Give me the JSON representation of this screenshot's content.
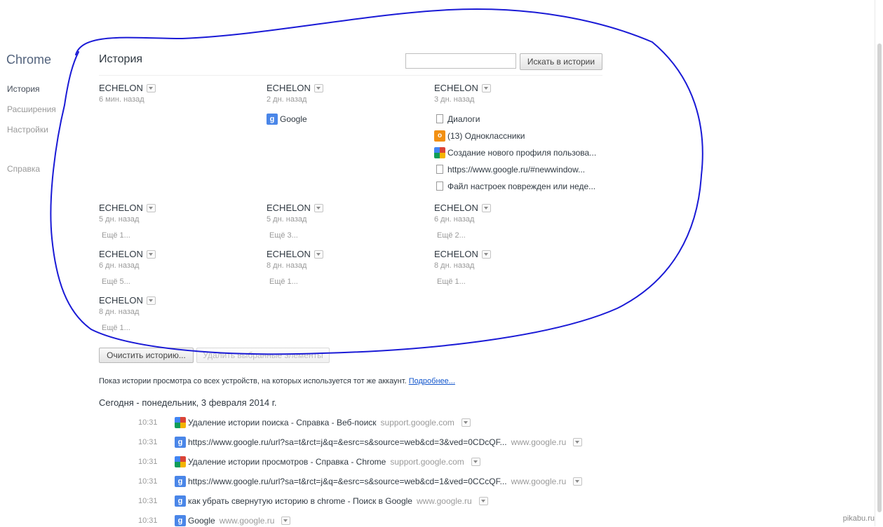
{
  "sidebar": {
    "app_title": "Chrome",
    "items": [
      {
        "label": "История",
        "active": true
      },
      {
        "label": "Расширения",
        "active": false
      },
      {
        "label": "Настройки",
        "active": false
      },
      {
        "label": "Справка",
        "active": false
      }
    ]
  },
  "header": {
    "title": "История",
    "search_placeholder": "",
    "search_button": "Искать в истории"
  },
  "devices": [
    {
      "name": "ECHELON",
      "time": "6 мин. назад",
      "tabs": []
    },
    {
      "name": "ECHELON",
      "time": "2 дн. назад",
      "tabs": [
        {
          "icon": "google-icon",
          "title": "Google"
        }
      ]
    },
    {
      "name": "ECHELON",
      "time": "3 дн. назад",
      "tabs": [
        {
          "icon": "page-icon",
          "title": "Диалоги"
        },
        {
          "icon": "odnoklassniki-icon",
          "title": "(13) Одноклассники"
        },
        {
          "icon": "google-multicolor-icon",
          "title": "Создание нового профиля пользова..."
        },
        {
          "icon": "page-icon",
          "title": "https://www.google.ru/#newwindow..."
        },
        {
          "icon": "page-icon",
          "title": "Файл настроек поврежден или неде..."
        }
      ]
    },
    {
      "name": "ECHELON",
      "time": "5 дн. назад",
      "more": "Ещё 1..."
    },
    {
      "name": "ECHELON",
      "time": "5 дн. назад",
      "more": "Ещё 3..."
    },
    {
      "name": "ECHELON",
      "time": "6 дн. назад",
      "more": "Ещё 2..."
    },
    {
      "name": "ECHELON",
      "time": "6 дн. назад",
      "more": "Ещё 5..."
    },
    {
      "name": "ECHELON",
      "time": "8 дн. назад",
      "more": "Ещё 1..."
    },
    {
      "name": "ECHELON",
      "time": "8 дн. назад",
      "more": "Ещё 1..."
    },
    {
      "name": "ECHELON",
      "time": "8 дн. назад",
      "more": "Ещё 1..."
    }
  ],
  "actions": {
    "clear_history": "Очистить историю...",
    "remove_selected": "Удалить выбранные элементы"
  },
  "info": {
    "text": "Показ истории просмотра со всех устройств, на которых используется тот же аккаунт.",
    "link": "Подробнее..."
  },
  "day_heading": "Сегодня - понедельник, 3 февраля 2014 г.",
  "entries": [
    {
      "time": "10:31",
      "icon": "google-multicolor-icon",
      "title": "Удаление истории поиска - Справка - Веб-поиск",
      "domain": "support.google.com"
    },
    {
      "time": "10:31",
      "icon": "google-icon",
      "title": "https://www.google.ru/url?sa=t&rct=j&q=&esrc=s&source=web&cd=3&ved=0CDcQF...",
      "domain": "www.google.ru"
    },
    {
      "time": "10:31",
      "icon": "google-multicolor-icon",
      "title": "Удаление истории просмотров - Справка - Chrome",
      "domain": "support.google.com"
    },
    {
      "time": "10:31",
      "icon": "google-icon",
      "title": "https://www.google.ru/url?sa=t&rct=j&q=&esrc=s&source=web&cd=1&ved=0CCcQF...",
      "domain": "www.google.ru"
    },
    {
      "time": "10:31",
      "icon": "google-icon",
      "title": "как убрать свернутую историю в chrome - Поиск в Google",
      "domain": "www.google.ru"
    },
    {
      "time": "10:31",
      "icon": "google-icon",
      "title": "Google",
      "domain": "www.google.ru"
    }
  ],
  "watermark": "pikabu.ru",
  "colors": {
    "annotation": "#1a1ad6",
    "link": "#1155cc"
  }
}
